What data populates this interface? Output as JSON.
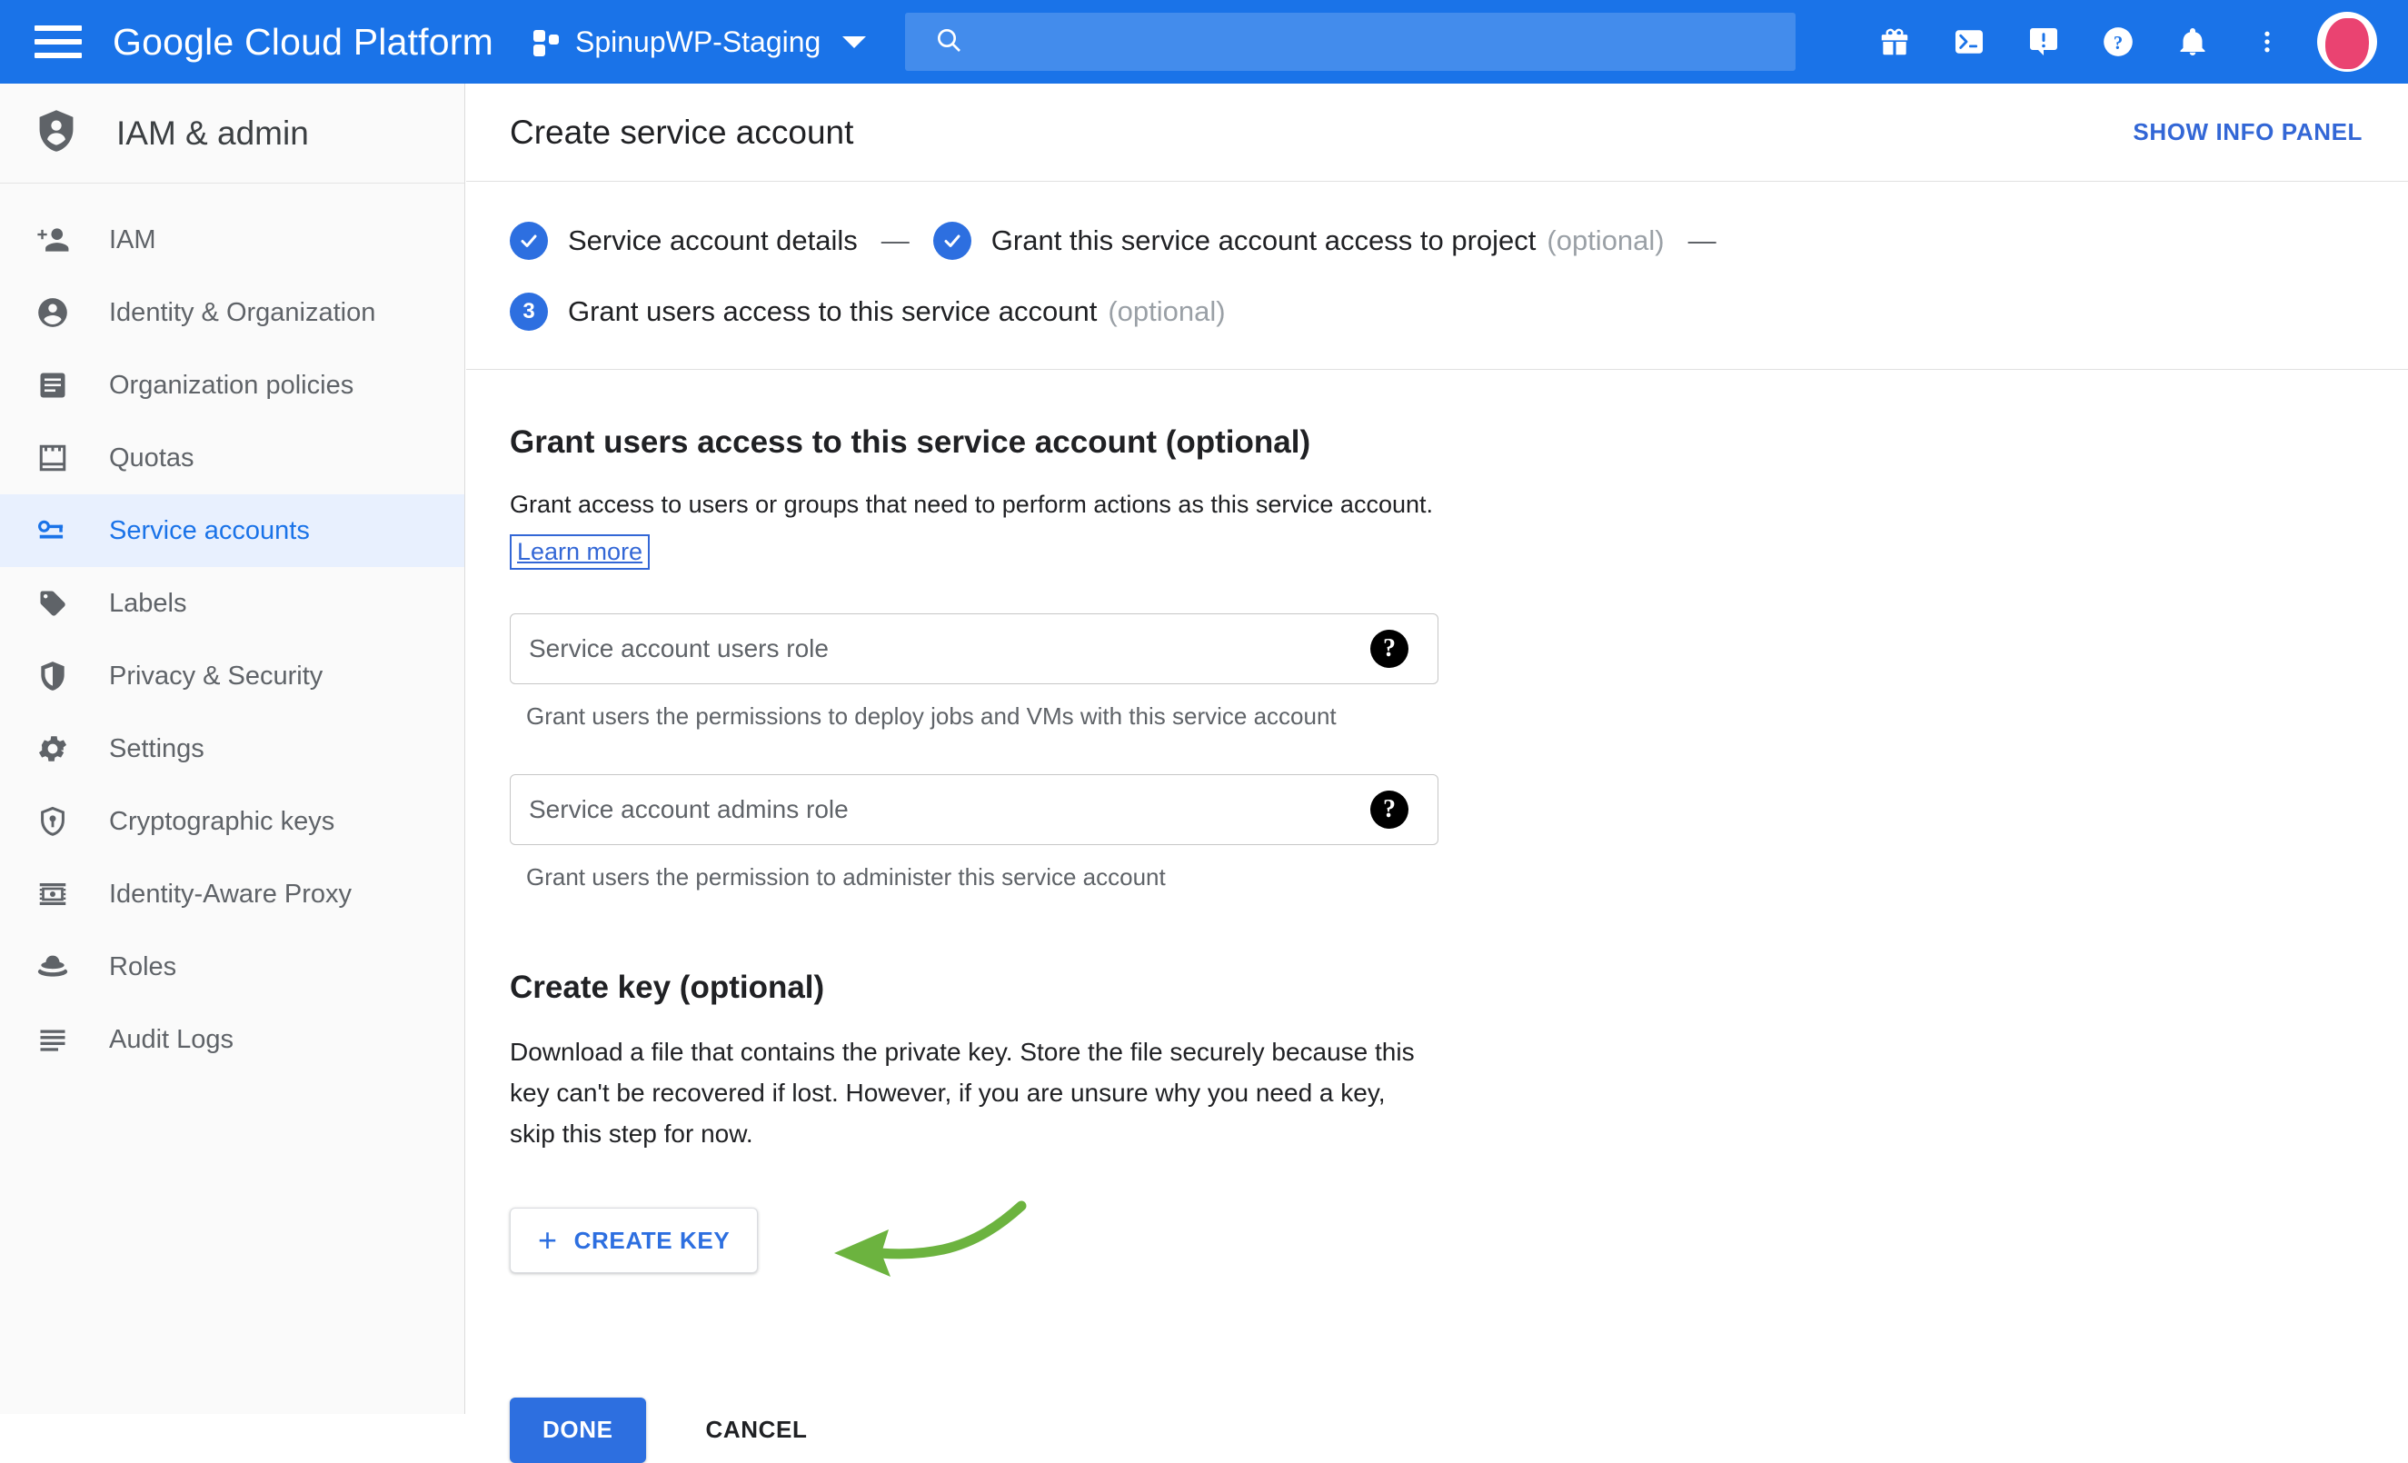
{
  "topbar": {
    "brand": "Google Cloud Platform",
    "project_name": "SpinupWP-Staging",
    "search_value": "",
    "search_placeholder": "",
    "icons": [
      "menu-icon",
      "project-selector-icon",
      "chevron-down-icon",
      "search-icon",
      "gift-icon",
      "cloud-shell-terminal-icon",
      "feedback-icon",
      "help-icon",
      "notifications-bell-icon",
      "more-vert-icon",
      "user-avatar"
    ]
  },
  "sidebar": {
    "title": "IAM & admin",
    "title_icon": "shield-person-icon",
    "items": [
      {
        "label": "IAM",
        "icon": "person-add-icon",
        "active": false
      },
      {
        "label": "Identity & Organization",
        "icon": "account-circle-icon",
        "active": false
      },
      {
        "label": "Organization policies",
        "icon": "policy-list-icon",
        "active": false
      },
      {
        "label": "Quotas",
        "icon": "quotas-chart-icon",
        "active": false
      },
      {
        "label": "Service accounts",
        "icon": "key-card-icon",
        "active": true
      },
      {
        "label": "Labels",
        "icon": "label-tag-icon",
        "active": false
      },
      {
        "label": "Privacy & Security",
        "icon": "shield-security-icon",
        "active": false
      },
      {
        "label": "Settings",
        "icon": "gear-icon",
        "active": false
      },
      {
        "label": "Cryptographic keys",
        "icon": "shield-key-icon",
        "active": false
      },
      {
        "label": "Identity-Aware Proxy",
        "icon": "proxy-icon",
        "active": false
      },
      {
        "label": "Roles",
        "icon": "roles-hat-icon",
        "active": false
      },
      {
        "label": "Audit Logs",
        "icon": "audit-lines-icon",
        "active": false
      }
    ]
  },
  "page": {
    "title": "Create service account",
    "info_panel_link": "SHOW INFO PANEL"
  },
  "stepper": {
    "steps": [
      {
        "marker": "check-icon",
        "label": "Service account details",
        "optional": "",
        "done": true
      },
      {
        "marker": "check-icon",
        "label": "Grant this service account access to project",
        "optional": "(optional)",
        "done": true
      },
      {
        "marker": "3",
        "label": "Grant users access to this service account",
        "optional": "(optional)",
        "done": false
      }
    ],
    "separator": "—"
  },
  "grant_section": {
    "heading": "Grant users access to this service account (optional)",
    "description": "Grant access to users or groups that need to perform actions as this service account.",
    "learn_more": "Learn more",
    "fields": [
      {
        "placeholder": "Service account users role",
        "value": "",
        "hint": "Grant users the permissions to deploy jobs and VMs with this service account",
        "help_icon": "help-circle-icon"
      },
      {
        "placeholder": "Service account admins role",
        "value": "",
        "hint": "Grant users the permission to administer this service account",
        "help_icon": "help-circle-icon"
      }
    ]
  },
  "create_key_section": {
    "heading": "Create key (optional)",
    "description": "Download a file that contains the private key. Store the file securely because this key can't be recovered if lost. However, if you are unsure why you need a key, skip this step for now.",
    "button_label": "CREATE KEY",
    "button_plus": "+",
    "annotation": "green-hand-drawn-arrow-pointing-left"
  },
  "footer": {
    "done_label": "DONE",
    "cancel_label": "CANCEL"
  },
  "colors": {
    "header_blue": "#1a73e8",
    "accent_blue": "#2d6fe0",
    "link_blue": "#3367d6",
    "active_nav_bg": "#e8f0fe",
    "sidebar_bg": "#fafafa",
    "annotation_green": "#6cb33f",
    "avatar_pink": "#ea4371"
  }
}
